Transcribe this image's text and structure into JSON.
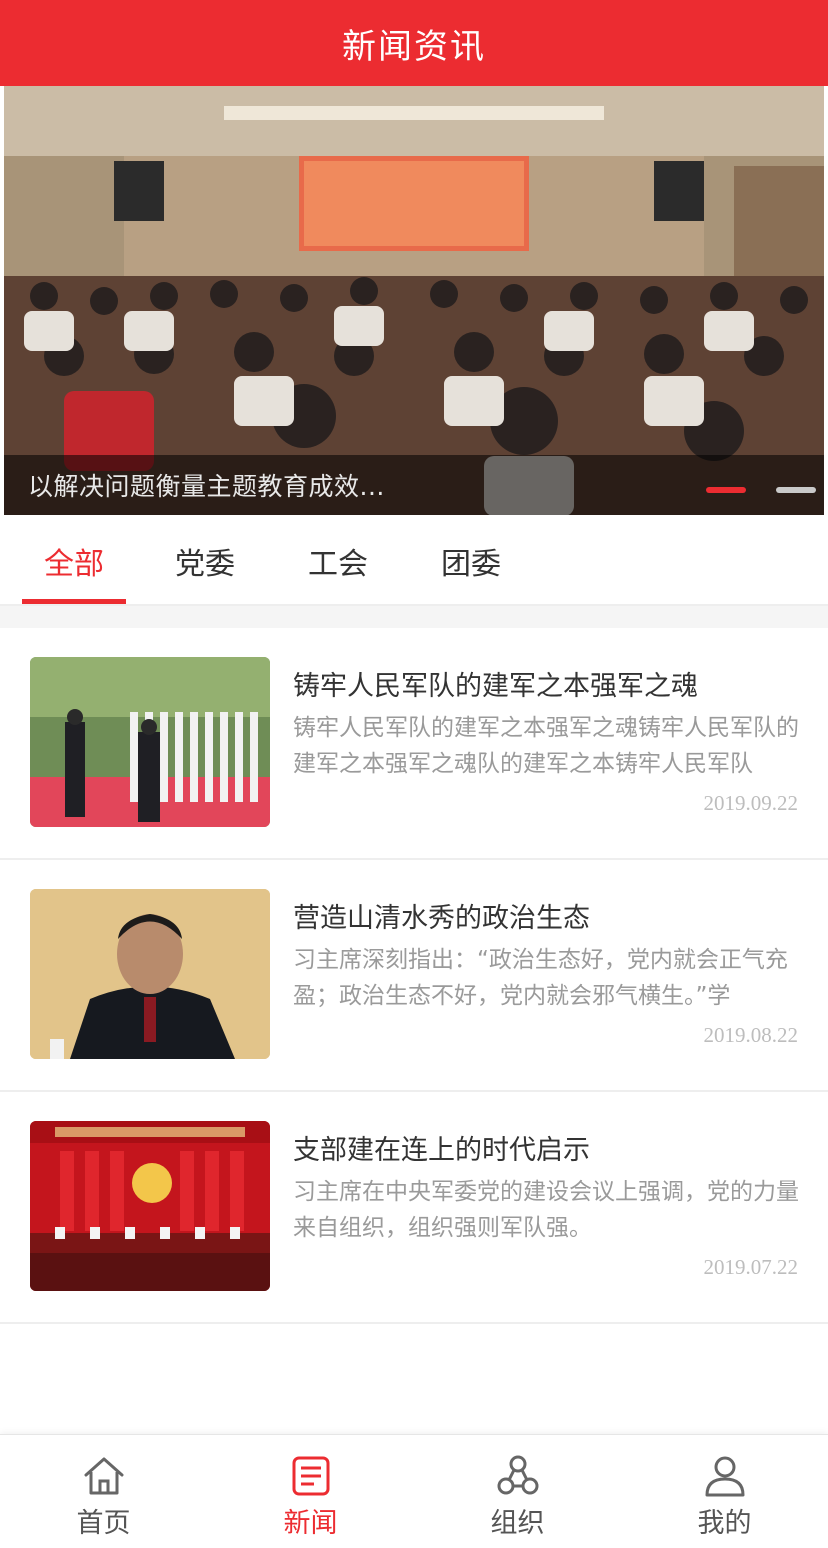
{
  "header": {
    "title": "新闻资讯"
  },
  "banner": {
    "caption": "以解决问题衡量主题教育成效...",
    "dots_total": 2,
    "active_dot": 1,
    "accent_color": "#ec2c31"
  },
  "tabs": [
    {
      "label": "全部",
      "active": true
    },
    {
      "label": "党委",
      "active": false
    },
    {
      "label": "工会",
      "active": false
    },
    {
      "label": "团委",
      "active": false
    }
  ],
  "news": [
    {
      "title": "铸牢人民军队的建军之本强军之魂",
      "summary": "铸牢人民军队的建军之本强军之魂铸牢人民军队的建军之本强军之魂队的建军之本铸牢人民军队",
      "date": "2019.09.22"
    },
    {
      "title": "营造山清水秀的政治生态",
      "summary": "习主席深刻指出：“政治生态好，党内就会正气充盈；政治生态不好，党内就会邪气横生。”学",
      "date": "2019.08.22"
    },
    {
      "title": "支部建在连上的时代启示",
      "summary": "习主席在中央军委党的建设会议上强调，党的力量来自组织，组织强则军队强。",
      "date": "2019.07.22"
    }
  ],
  "tabbar": [
    {
      "label": "首页",
      "icon": "home-icon",
      "active": false
    },
    {
      "label": "新闻",
      "icon": "news-icon",
      "active": true
    },
    {
      "label": "组织",
      "icon": "organization-icon",
      "active": false
    },
    {
      "label": "我的",
      "icon": "user-icon",
      "active": false
    }
  ]
}
